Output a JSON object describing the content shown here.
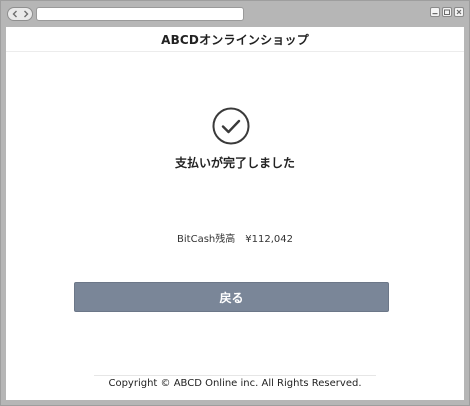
{
  "shop": {
    "title": "ABCDオンラインショップ"
  },
  "result": {
    "message": "支払いが完了しました",
    "icon": "check-circle-icon"
  },
  "balance": {
    "label": "BitCash残高",
    "amount": "¥112,042"
  },
  "actions": {
    "back_label": "戻る"
  },
  "footer": {
    "copyright": "Copyright © ABCD Online inc. All Rights Reserved."
  },
  "colors": {
    "button_bg": "#7a8698",
    "window_chrome": "#b6b6b6",
    "text": "#222222"
  }
}
